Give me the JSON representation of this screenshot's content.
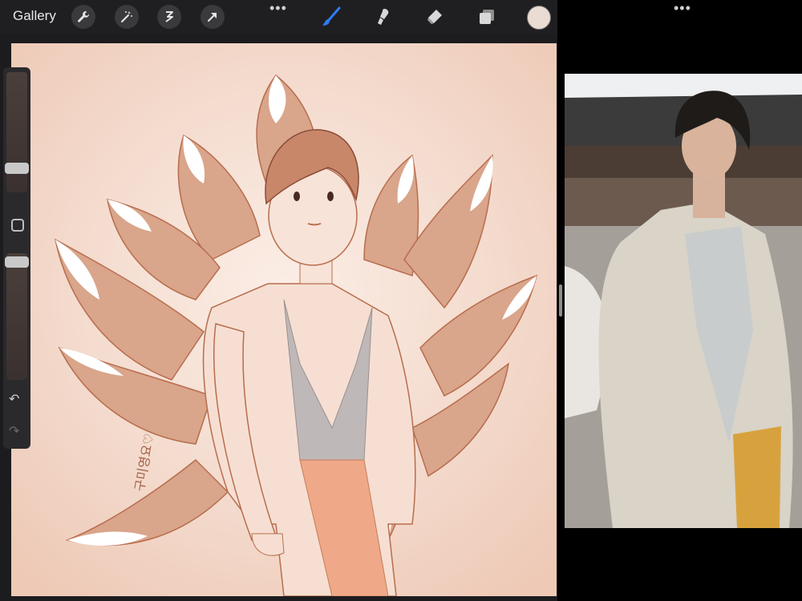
{
  "topbar": {
    "gallery_label": "Gallery",
    "tools_left": [
      "wrench-icon",
      "magic-wand-icon",
      "selection-icon",
      "transform-arrow-icon"
    ],
    "tools_right": [
      "brush-icon",
      "smudge-icon",
      "eraser-icon",
      "layers-icon"
    ],
    "more_glyph": "•••",
    "current_color": "#eadcd2"
  },
  "canvas": {
    "background": "#f2d8c9",
    "signature_text": "구미영요♡"
  },
  "sidebar": {
    "undo_glyph": "↶",
    "redo_glyph": "↷"
  },
  "reference": {
    "more_glyph": "•••"
  }
}
